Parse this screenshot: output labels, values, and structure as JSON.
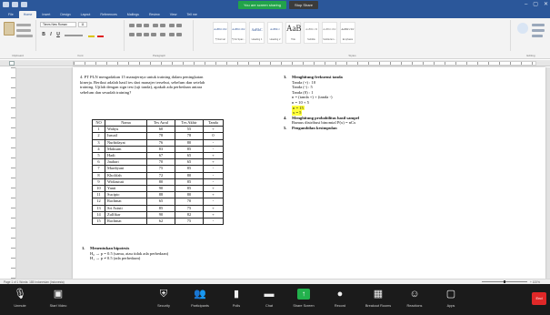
{
  "titlebar": {
    "share_status": "You are screen sharing",
    "stop_share": "Stop Share",
    "window_controls": [
      "–",
      "▢",
      "✕"
    ]
  },
  "tabs": [
    "File",
    "Home",
    "Insert",
    "Design",
    "Layout",
    "References",
    "Mailings",
    "Review",
    "View",
    "Tell me"
  ],
  "ribbon": {
    "font_name": "Times New Roman",
    "font_size": "11",
    "format_buttons": [
      "B",
      "I",
      "U"
    ],
    "group_labels": [
      "Clipboard",
      "Font",
      "Paragraph",
      "Styles",
      "Editing"
    ],
    "styles": [
      {
        "sample": "AaBbCcDc",
        "name": "¶ Normal"
      },
      {
        "sample": "AaBbCcDc",
        "name": "¶ No Spac..."
      },
      {
        "sample": "AaBbC",
        "name": "Heading 1"
      },
      {
        "sample": "AaBbCc",
        "name": "Heading 2"
      },
      {
        "sample": "AaB",
        "name": "Title"
      },
      {
        "sample": "AaBbCcD",
        "name": "Subtitle"
      },
      {
        "sample": "AaBbCcDc",
        "name": "Subtle Em..."
      },
      {
        "sample": "AaBbCcDc",
        "name": "Emphasis"
      }
    ],
    "colors": {
      "title_bar": "#2b579a",
      "font_color_bar": "#e02020",
      "highlight": "#ffff3a"
    }
  },
  "document": {
    "intro": "4. PT PLN mengadakan 15 manajernya untuk training dalam peningkatan kinerja. Berikut adalah hasil tes dari manajer tersebut, sebelum dan setelah training. Ujilah dengan sign test (uji tanda), apakah ada perbedaan antara sebelum dan sesudah training?",
    "table": {
      "headers": [
        "NO",
        "Nama",
        "Tes Awal",
        "Tes Akhir",
        "Tanda"
      ],
      "rows": [
        [
          "1",
          "Wahyu",
          "60",
          "55",
          "+"
        ],
        [
          "2",
          "Ismail",
          "78",
          "78",
          "0"
        ],
        [
          "3",
          "Nurhidayat",
          "76",
          "80",
          "-"
        ],
        [
          "4",
          "Maksum",
          "83",
          "85",
          "-"
        ],
        [
          "5",
          "Hadi",
          "67",
          "65",
          "+"
        ],
        [
          "6",
          "Jauhari",
          "70",
          "65",
          "+"
        ],
        [
          "7",
          "Mardiyani",
          "75",
          "85",
          "-"
        ],
        [
          "8",
          "Kholifah",
          "72",
          "80",
          "-"
        ],
        [
          "9",
          "Widiastuti",
          "80",
          "85",
          "-"
        ],
        [
          "10",
          "Yanti",
          "90",
          "85",
          "+"
        ],
        [
          "11",
          "Sucipto",
          "88",
          "80",
          "+"
        ],
        [
          "12",
          "Rachmat",
          "65",
          "70",
          "-"
        ],
        [
          "13",
          "Sri Astuti",
          "85",
          "75",
          "+"
        ],
        [
          "14",
          "Zulfikar",
          "90",
          "82",
          "+"
        ],
        [
          "15",
          "Rachmat",
          "62",
          "75",
          "-"
        ]
      ]
    },
    "section1": {
      "num": "1.",
      "heading": "Menentukan hipotesis",
      "h0": "H₀ → p = 0.5 (sama, atau tidak ada perbedaan)",
      "h1": "H₁ → p ≠ 0.5 (ada perbedaan)"
    },
    "right": {
      "s3_num": "3.",
      "s3_heading": "Menghitung frekuensi tanda",
      "tanda_plus": "Tanda (+) : 10",
      "tanda_minus": "Tanda (-) : 5",
      "tanda_zero": "Tanda (0) : 1",
      "n_formula": "n = (tanda +) + (tanda -)",
      "n_calc": "n = 10 + 5",
      "n_result": "n = 15",
      "x_result": "x = 5",
      "s4_num": "4.",
      "s4_heading": "Menghitung probabilitas hasil sampel",
      "s4_body": "Rumus distribusi binomial P(x) = nCx",
      "s5_num": "5.",
      "s5_heading": "Pengambilan kesimpulan"
    }
  },
  "statusbar": {
    "text": "Page 1 of 1    Words: 185    Indonesian (Indonesia)",
    "zoom": "+ 100%"
  },
  "zoom_toolbar": {
    "buttons": [
      {
        "label": "Unmute",
        "icon": "🎙"
      },
      {
        "label": "Start Video",
        "icon": "▣"
      },
      {
        "label": "Security",
        "icon": "⛨"
      },
      {
        "label": "Participants",
        "icon": "👥"
      },
      {
        "label": "Polls",
        "icon": "▮"
      },
      {
        "label": "Chat",
        "icon": "▬"
      },
      {
        "label": "Share Screen",
        "icon": "↑"
      },
      {
        "label": "Record",
        "icon": "●"
      },
      {
        "label": "Breakout Rooms",
        "icon": "▦"
      },
      {
        "label": "Reactions",
        "icon": "☺"
      },
      {
        "label": "Apps",
        "icon": "▢"
      }
    ],
    "end_label": "End"
  }
}
